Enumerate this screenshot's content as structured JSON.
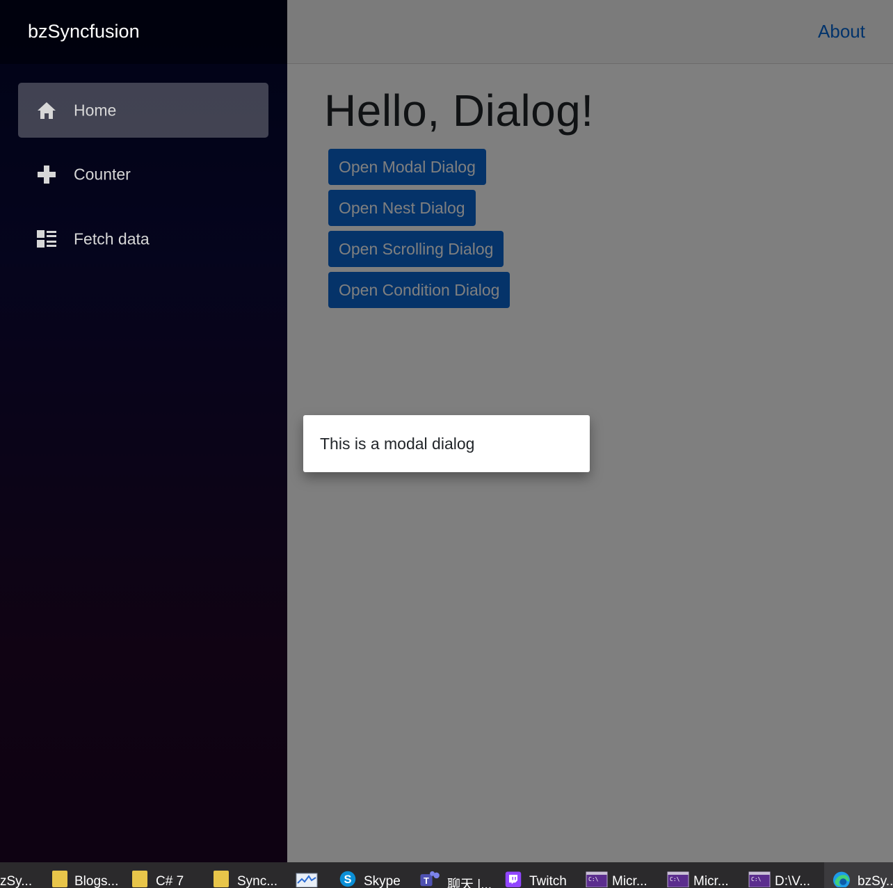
{
  "app": {
    "brand": "bzSyncfusion"
  },
  "topbar": {
    "about_label": "About"
  },
  "sidebar": {
    "items": [
      {
        "label": "Home",
        "icon": "home-icon",
        "active": true
      },
      {
        "label": "Counter",
        "icon": "plus-icon",
        "active": false
      },
      {
        "label": "Fetch data",
        "icon": "list-icon",
        "active": false
      }
    ]
  },
  "main": {
    "title": "Hello, Dialog!",
    "buttons": [
      {
        "label": "Open Modal Dialog"
      },
      {
        "label": "Open Nest Dialog"
      },
      {
        "label": "Open Scrolling Dialog"
      },
      {
        "label": "Open Condition Dialog"
      }
    ]
  },
  "dialog": {
    "text": "This is a modal dialog"
  },
  "taskbar": {
    "items": [
      {
        "label": "zSy...",
        "icon": "edge-icon"
      },
      {
        "label": "Blogs...",
        "icon": "folder-icon"
      },
      {
        "label": "C# 7",
        "icon": "folder-icon"
      },
      {
        "label": "Sync...",
        "icon": "folder-icon"
      },
      {
        "label": "",
        "icon": "resource-monitor-icon"
      },
      {
        "label": "Skype",
        "icon": "skype-icon"
      },
      {
        "label": "聊天 |...",
        "icon": "teams-icon"
      },
      {
        "label": "Twitch",
        "icon": "twitch-icon"
      },
      {
        "label": "Micr...",
        "icon": "terminal-icon"
      },
      {
        "label": "Micr...",
        "icon": "terminal-icon"
      },
      {
        "label": "D:\\V...",
        "icon": "terminal-icon"
      },
      {
        "label": "bzSy...",
        "icon": "edge-icon",
        "active": true
      }
    ]
  },
  "colors": {
    "primary_button": "#0a66d2",
    "link": "#0366d6",
    "overlay": "rgba(0,0,0,0.5)"
  }
}
